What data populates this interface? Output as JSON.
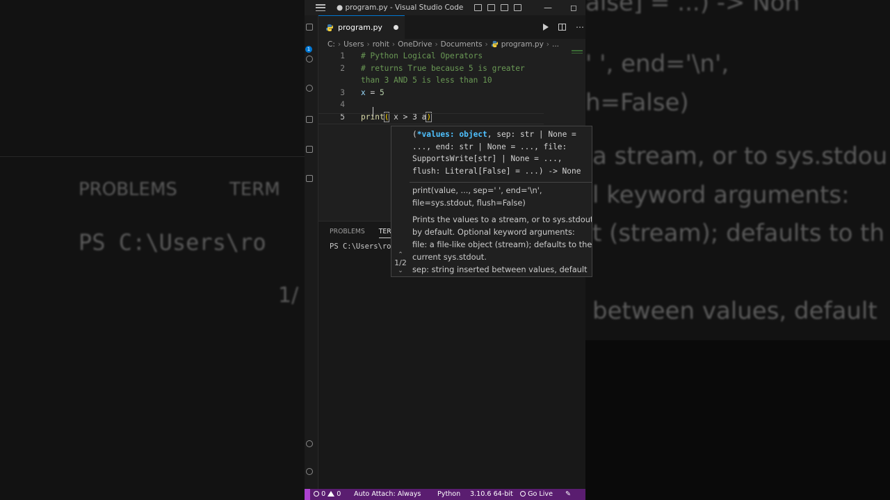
{
  "window": {
    "title": "● program.py - Visual Studio Code"
  },
  "tab": {
    "label": "program.py"
  },
  "breadcrumb": [
    "C:",
    "Users",
    "rohit",
    "OneDrive",
    "Documents",
    "program.py",
    "..."
  ],
  "activity": {
    "badge": "1"
  },
  "editor": {
    "lines": [
      {
        "num": "1",
        "text": "# Python Logical Operators"
      },
      {
        "num": "2",
        "text": "# returns True because 5 is greater"
      },
      {
        "num": "",
        "text": "than 3 AND 5 is less than 10"
      },
      {
        "num": "3",
        "var": "x",
        "op": " = ",
        "val": "5"
      },
      {
        "num": "4",
        "text": ""
      },
      {
        "num": "5",
        "fn": "print",
        "open": "(",
        "body": " x > 3 a",
        "close": ")"
      }
    ]
  },
  "hover": {
    "sig_line1_open": "(",
    "sig_line1_active": "*values: object",
    "sig_line1_rest": ", sep: str | None =",
    "sig_line2": "..., end: str | None = ..., file:",
    "sig_line3": "SupportsWrite[str] | None = ...,",
    "sig_line4": "flush: Literal[False] = ...) -> None",
    "usage_line1": "print(value, ..., sep=' ', end='\\n',",
    "usage_line2": "file=sys.stdout, flush=False)",
    "doc_line1": "Prints the values to a stream, or to sys.stdout",
    "doc_line2": "by default. Optional keyword arguments:",
    "doc_line3": "file: a file-like object (stream); defaults to the",
    "doc_line4": "current sys.stdout.",
    "doc_line5": "sep: string inserted between values, default",
    "overload": "1/2"
  },
  "panel": {
    "tabs": [
      "PROBLEMS",
      "TERM"
    ],
    "prompt": "PS C:\\Users\\ro"
  },
  "statusbar": {
    "errors": "0",
    "warnings": "0",
    "auto_attach": "Auto Attach: Always",
    "language": "Python",
    "interpreter": "3.10.6 64-bit",
    "go_live": "Go Live"
  },
  "background": {
    "right_line1": "alse] = ...) -> Non",
    "right_line2": "' ', end='\\n',",
    "right_line3": "h=False)",
    "right_line4": "a stream, or to sys.stdou",
    "right_line5": "l keyword arguments:",
    "right_line6": "t (stream); defaults to th",
    "right_line7": "between values, default",
    "left_tab1": "PROBLEMS",
    "left_tab2": "TERM",
    "left_prompt": "PS C:\\Users\\ro",
    "left_overload": "1/"
  },
  "colors": {
    "accent": "#0078d4",
    "statusbar": "#5a1d70",
    "remote": "#ac42d0"
  }
}
